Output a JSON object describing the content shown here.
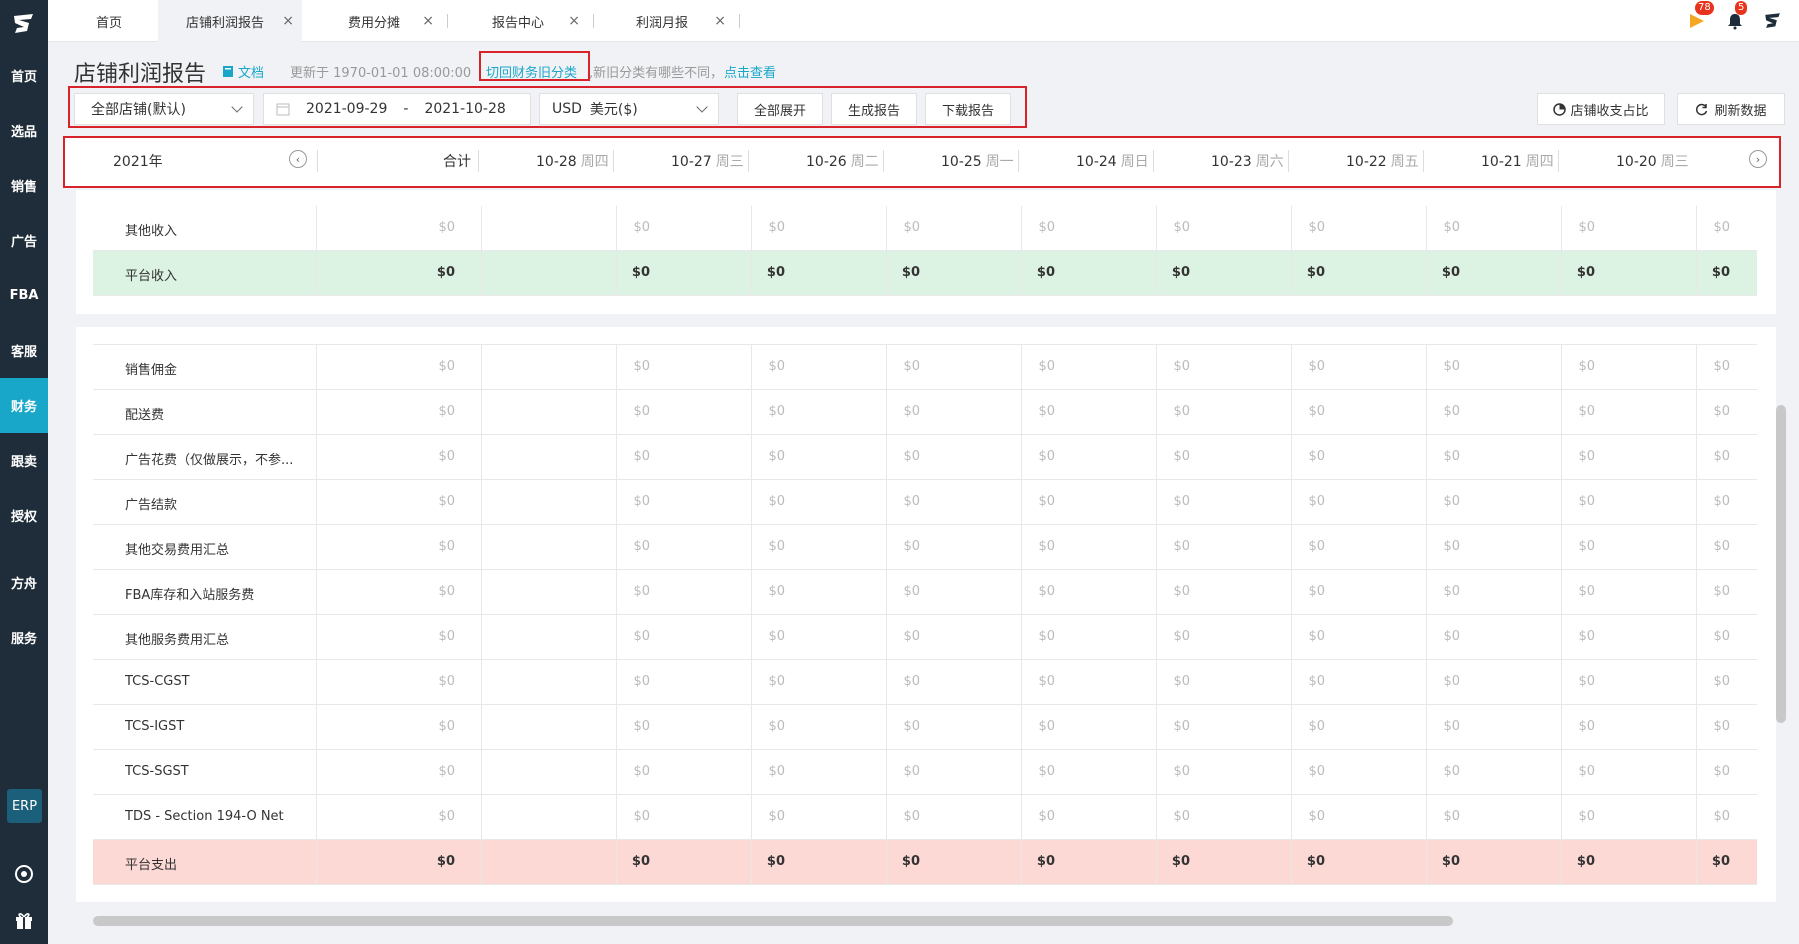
{
  "sidebar": {
    "items": [
      {
        "label": "首页"
      },
      {
        "label": "选品"
      },
      {
        "label": "销售"
      },
      {
        "label": "广告"
      },
      {
        "label": "FBA"
      },
      {
        "label": "客服"
      },
      {
        "label": "财务"
      },
      {
        "label": "跟卖"
      },
      {
        "label": "授权"
      },
      {
        "label": "方舟"
      },
      {
        "label": "服务"
      }
    ],
    "erp": "ERP",
    "active_color": "#19a7c9"
  },
  "tabs": [
    {
      "label": "首页"
    },
    {
      "label": "店铺利润报告"
    },
    {
      "label": "费用分摊"
    },
    {
      "label": "报告中心"
    },
    {
      "label": "利润月报"
    }
  ],
  "top_icons": {
    "flag_badge": "78",
    "bell_badge": "5"
  },
  "header": {
    "title": "店铺利润报告",
    "doc_link": "文档",
    "updated": "更新于 1970-01-01 08:00:00",
    "switch_link": "切回财务旧分类",
    "note": ",新旧分类有哪些不同，",
    "note_link": "点击查看"
  },
  "filters": {
    "store_select": "全部店铺(默认)",
    "date_start": "2021-09-29",
    "date_sep": "-",
    "date_end": "2021-10-28",
    "currency_code": "USD",
    "currency_name": "美元($)",
    "expand_all": "全部展开",
    "generate_report": "生成报告",
    "download_report": "下载报告",
    "ratio_button": "店铺收支占比",
    "refresh_button": "刷新数据"
  },
  "table_header": {
    "year": "2021年",
    "total": "合计",
    "dates": [
      {
        "date": "10-28",
        "weekday": "周四"
      },
      {
        "date": "10-27",
        "weekday": "周三"
      },
      {
        "date": "10-26",
        "weekday": "周二"
      },
      {
        "date": "10-25",
        "weekday": "周一"
      },
      {
        "date": "10-24",
        "weekday": "周日"
      },
      {
        "date": "10-23",
        "weekday": "周六"
      },
      {
        "date": "10-22",
        "weekday": "周五"
      },
      {
        "date": "10-21",
        "weekday": "周四"
      },
      {
        "date": "10-20",
        "weekday": "周三"
      }
    ]
  },
  "income_rows": [
    {
      "label": "其他收入",
      "values": [
        "$0",
        "$0",
        "$0",
        "$0",
        "$0",
        "$0",
        "$0",
        "$0",
        "$0",
        "$0"
      ]
    },
    {
      "label": "平台收入",
      "values": [
        "$0",
        "$0",
        "$0",
        "$0",
        "$0",
        "$0",
        "$0",
        "$0",
        "$0",
        "$0"
      ]
    }
  ],
  "expense_rows": [
    {
      "label": "销售佣金",
      "values": [
        "$0",
        "$0",
        "$0",
        "$0",
        "$0",
        "$0",
        "$0",
        "$0",
        "$0",
        "$0"
      ]
    },
    {
      "label": "配送费",
      "values": [
        "$0",
        "$0",
        "$0",
        "$0",
        "$0",
        "$0",
        "$0",
        "$0",
        "$0",
        "$0"
      ]
    },
    {
      "label": "广告花费（仅做展示，不参...",
      "values": [
        "$0",
        "$0",
        "$0",
        "$0",
        "$0",
        "$0",
        "$0",
        "$0",
        "$0",
        "$0"
      ]
    },
    {
      "label": "广告结款",
      "values": [
        "$0",
        "$0",
        "$0",
        "$0",
        "$0",
        "$0",
        "$0",
        "$0",
        "$0",
        "$0"
      ]
    },
    {
      "label": "其他交易费用汇总",
      "values": [
        "$0",
        "$0",
        "$0",
        "$0",
        "$0",
        "$0",
        "$0",
        "$0",
        "$0",
        "$0"
      ]
    },
    {
      "label": "FBA库存和入站服务费",
      "values": [
        "$0",
        "$0",
        "$0",
        "$0",
        "$0",
        "$0",
        "$0",
        "$0",
        "$0",
        "$0"
      ]
    },
    {
      "label": "其他服务费用汇总",
      "values": [
        "$0",
        "$0",
        "$0",
        "$0",
        "$0",
        "$0",
        "$0",
        "$0",
        "$0",
        "$0"
      ]
    },
    {
      "label": "TCS-CGST",
      "values": [
        "$0",
        "$0",
        "$0",
        "$0",
        "$0",
        "$0",
        "$0",
        "$0",
        "$0",
        "$0"
      ]
    },
    {
      "label": "TCS-IGST",
      "values": [
        "$0",
        "$0",
        "$0",
        "$0",
        "$0",
        "$0",
        "$0",
        "$0",
        "$0",
        "$0"
      ]
    },
    {
      "label": "TCS-SGST",
      "values": [
        "$0",
        "$0",
        "$0",
        "$0",
        "$0",
        "$0",
        "$0",
        "$0",
        "$0",
        "$0"
      ]
    },
    {
      "label": "TDS - Section 194-O Net",
      "values": [
        "$0",
        "$0",
        "$0",
        "$0",
        "$0",
        "$0",
        "$0",
        "$0",
        "$0",
        "$0"
      ]
    },
    {
      "label": "平台支出",
      "values": [
        "$0",
        "$0",
        "$0",
        "$0",
        "$0",
        "$0",
        "$0",
        "$0",
        "$0",
        "$0"
      ]
    }
  ]
}
